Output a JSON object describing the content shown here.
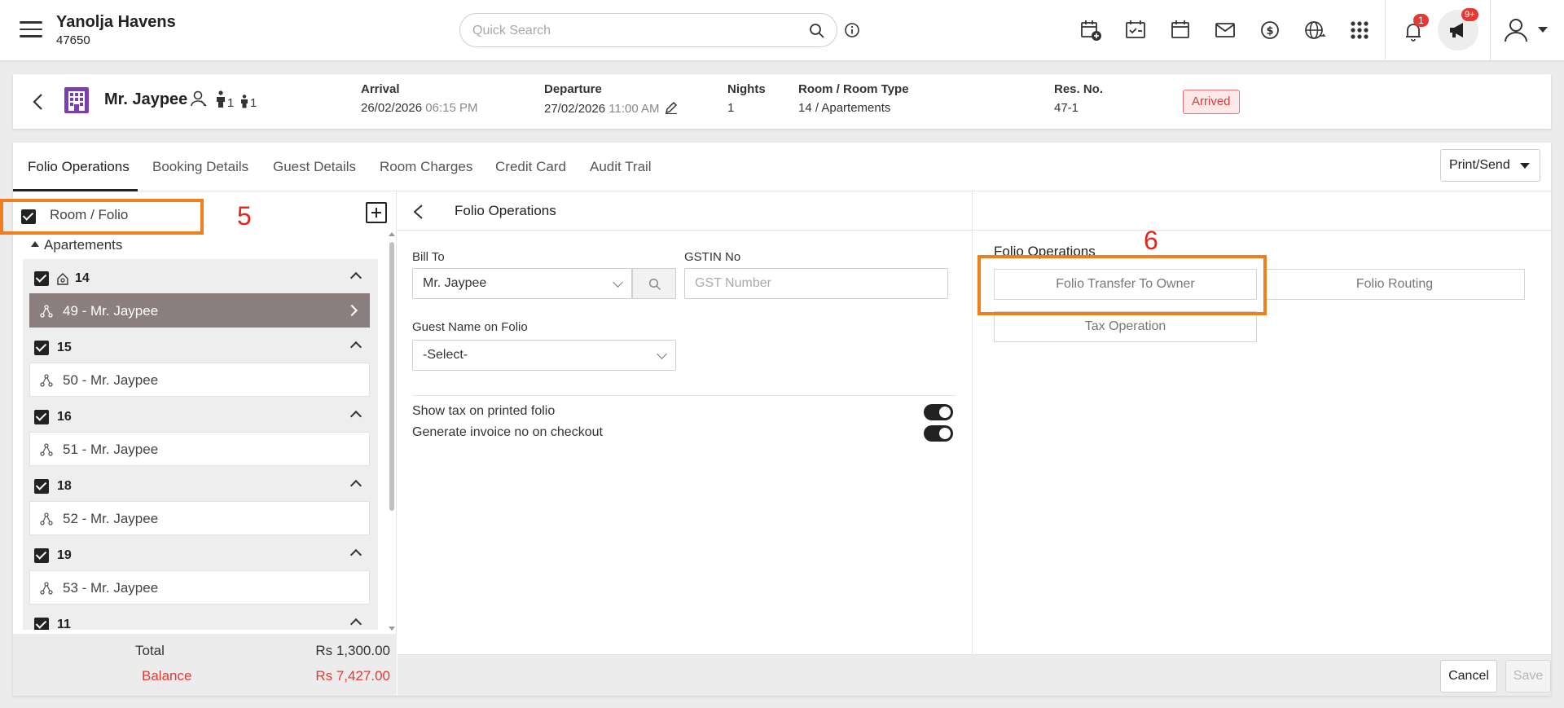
{
  "topbar": {
    "hotel_name": "Yanolja Havens",
    "hotel_id": "47650",
    "search_placeholder": "Quick Search",
    "notification_count": "1",
    "announcement_count": "9+",
    "icons": [
      "calendar-add-icon",
      "calendar-check-icon",
      "calendar-icon",
      "mail-icon",
      "dollar-icon",
      "globe-icon",
      "apps-grid-icon",
      "bell-icon",
      "megaphone-icon",
      "user-icon"
    ]
  },
  "reservation": {
    "guest_name": "Mr. Jaypee",
    "adults": "1",
    "children": "1",
    "arrival_label": "Arrival",
    "arrival_date": "26/02/2026",
    "arrival_time": "06:15 PM",
    "departure_label": "Departure",
    "departure_date": "27/02/2026",
    "departure_time": "11:00 AM",
    "nights_label": "Nights",
    "nights": "1",
    "room_type_label": "Room / Room Type",
    "room_type": "14 / Apartements",
    "res_no_label": "Res. No.",
    "res_no": "47-1",
    "status": "Arrived",
    "status_color": "#d93a3a"
  },
  "tabs": [
    "Folio Operations",
    "Booking Details",
    "Guest Details",
    "Room Charges",
    "Credit Card",
    "Audit Trail"
  ],
  "print_send": "Print/Send",
  "left_panel": {
    "room_folio_label": "Room / Folio",
    "annotation_5": "5",
    "group": "Apartements",
    "rooms": [
      {
        "number": "14",
        "folio": "49 - Mr. Jaypee"
      },
      {
        "number": "15",
        "folio": "50 - Mr. Jaypee"
      },
      {
        "number": "16",
        "folio": "51 - Mr. Jaypee"
      },
      {
        "number": "18",
        "folio": "52 - Mr. Jaypee"
      },
      {
        "number": "19",
        "folio": "53 - Mr. Jaypee"
      },
      {
        "number": "11",
        "folio": ""
      }
    ],
    "total_label": "Total",
    "total_value": "Rs 1,300.00",
    "balance_label": "Balance",
    "balance_value": "Rs 7,427.00"
  },
  "middle_panel": {
    "title": "Folio Operations",
    "bill_to_label": "Bill To",
    "bill_to_value": "Mr. Jaypee",
    "gstin_label": "GSTIN No",
    "gstin_placeholder": "GST Number",
    "guest_name_folio_label": "Guest Name on Folio",
    "guest_name_folio_value": "-Select-",
    "toggle_tax_label": "Show tax on printed folio",
    "toggle_invoice_label": "Generate invoice no on checkout"
  },
  "right_panel": {
    "title": "Folio Operations",
    "annotation_6": "6",
    "btn_transfer": "Folio Transfer To Owner",
    "btn_routing": "Folio Routing",
    "btn_tax": "Tax Operation"
  },
  "footer": {
    "cancel": "Cancel",
    "save": "Save"
  },
  "colors": {
    "highlight": "#f07d1e",
    "annotation": "#e3261b",
    "accent_dark": "#222222",
    "selected_folio": "#8a7e7e",
    "balance": "#e53935"
  }
}
